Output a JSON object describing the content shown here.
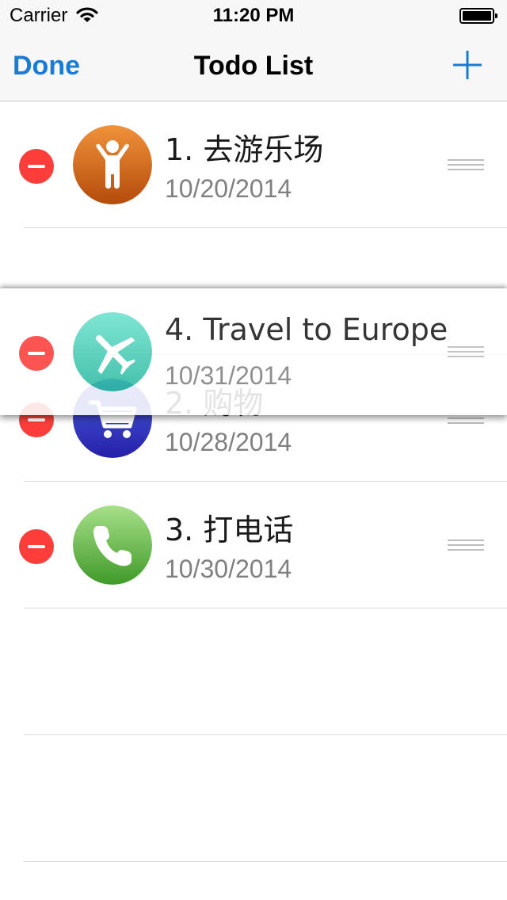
{
  "status_bar": {
    "carrier": "Carrier",
    "time": "11:20 PM"
  },
  "nav": {
    "done_label": "Done",
    "title": "Todo List"
  },
  "colors": {
    "accent": "#1a7bd6",
    "delete": "#fc3d39"
  },
  "todos": [
    {
      "title": "1. 去游乐场",
      "date": "10/20/2014",
      "icon": "child-icon",
      "color": "#d96b17"
    },
    {
      "title": "2. 购物",
      "date": "10/28/2014",
      "icon": "shopping-cart-icon",
      "color": "#3238c4"
    },
    {
      "title": "3. 打电话",
      "date": "10/30/2014",
      "icon": "phone-icon",
      "color": "#58b93e"
    }
  ],
  "dragging": {
    "title": "4. Travel to Europe",
    "date": "10/31/2014",
    "icon": "airplane-icon",
    "color": "#4fd4bf"
  }
}
